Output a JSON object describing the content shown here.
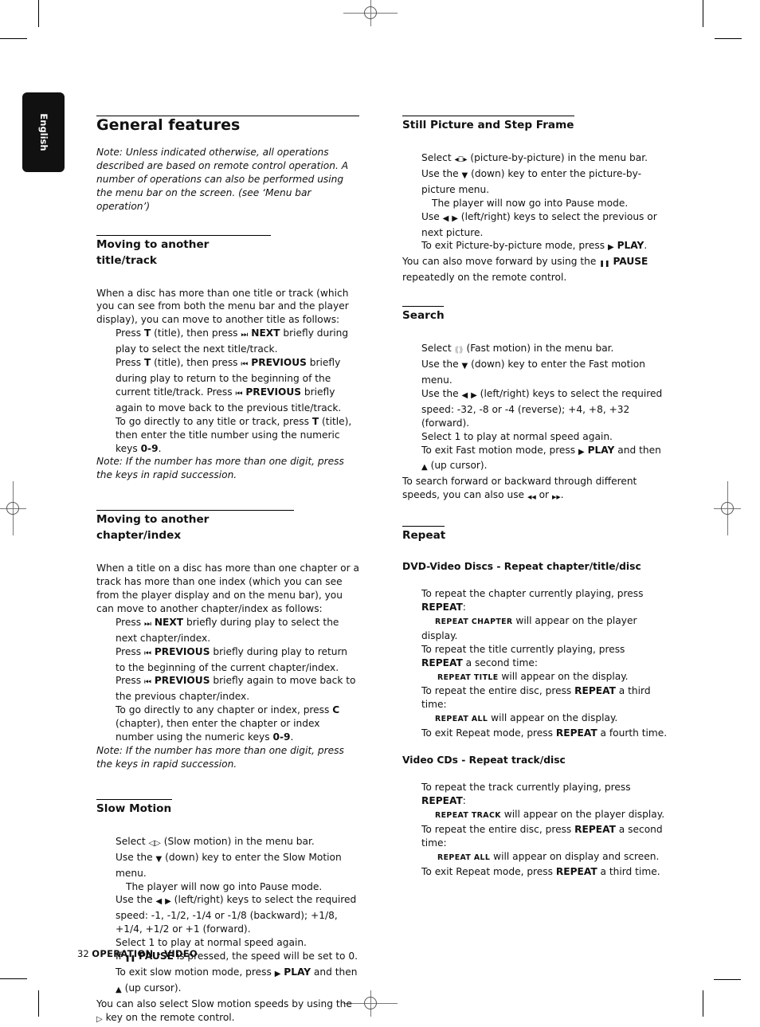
{
  "language_tab": "English",
  "page_title": "General features",
  "intro_note": "Note: Unless indicated otherwise, all operations described are based on remote control operation. A number of operations can also be performed using the menu bar on the screen. (see ‘Menu bar operation’)",
  "sections": {
    "title_track": {
      "heading": "Moving to another title/track",
      "intro": "When a disc has more than one title or track (which you can see from both the menu bar and the player display), you can move to another title as follows:",
      "step1": {
        "a": "Press ",
        "key": "T",
        "b": " (title), then press ",
        "btn": "NEXT",
        "c": " briefly during play to select the next title/track."
      },
      "step2": {
        "a": "Press ",
        "key": "T",
        "b": " (title), then press ",
        "btn": "PREVIOUS",
        "c": " briefly during play to return to the beginning of the current title/track. Press ",
        "btn2": "PREVIOUS",
        "d": " briefly again to move back to the previous title/track."
      },
      "step3": {
        "a": "To go directly to any title or track, press ",
        "key": "T",
        "b": " (title), then enter the title number using the numeric keys ",
        "keys": "0-9",
        "c": "."
      },
      "note": "Note: If the number has more than one digit, press the keys in rapid succession."
    },
    "chapter_index": {
      "heading": "Moving to another chapter/index",
      "intro": "When a title on a disc has more than one chapter or a track has more than one index (which you can see from the player display and on the menu bar), you can move to another chapter/index as follows:",
      "step1": {
        "a": "Press ",
        "btn": "NEXT",
        "b": " briefly during play to select the next chapter/index."
      },
      "step2": {
        "a": "Press ",
        "btn": "PREVIOUS",
        "b": " briefly during play to return to the beginning of the current chapter/index."
      },
      "step3": {
        "a": "Press ",
        "btn": "PREVIOUS",
        "b": " briefly again to move back to the previous chapter/index."
      },
      "step4": {
        "a": "To go directly to any chapter or index, press ",
        "key": "C",
        "b": " (chapter), then enter the chapter or index number using the numeric keys ",
        "keys": "0-9",
        "c": "."
      },
      "note": "Note: If the number has more than one digit, press the keys in rapid succession."
    },
    "slow_motion": {
      "heading": "Slow Motion",
      "s1a": "Select ",
      "s1b": " (Slow motion) in the menu bar.",
      "s2a": "Use the ",
      "s2b": " (down) key to enter the Slow Motion menu.",
      "s3": "The player will now go into Pause mode.",
      "s4a": "Use the ",
      "s4b": " (left/right) keys to select the required speed: -1, -1/2, -1/4 or -1/8 (backward); +1/8, +1/4, +1/2 or +1 (forward).",
      "s5": "Select 1 to play at normal speed again.",
      "s6a": "If ",
      "s6btn": "PAUSE",
      "s6b": " is pressed, the speed will be set to 0.",
      "s7a": "To exit slow motion mode, press ",
      "s7btn": "PLAY",
      "s7b": " and then",
      "s8": " (up cursor).",
      "s9a": "You can also select Slow motion speeds by using the ",
      "s9b": " key on the remote control."
    },
    "still_picture": {
      "heading": "Still Picture and Step Frame",
      "s1a": "Select ",
      "s1b": " (picture-by-picture) in the menu bar.",
      "s2a": "Use the ",
      "s2b": " (down) key to enter the picture-by-picture menu.",
      "s3": "The player will now go into Pause mode.",
      "s4a": "Use ",
      "s4b": " (left/right) keys to select the previous or next picture.",
      "s5a": "To exit Picture-by-picture mode, press ",
      "s5btn": "PLAY",
      "s5b": ".",
      "s6a": "You can also move forward by using the ",
      "s6btn": "PAUSE",
      "s6b": " repeatedly on the remote control."
    },
    "search": {
      "heading": "Search",
      "s1a": "Select ",
      "s1b": " (Fast motion) in the menu bar.",
      "s2a": "Use the ",
      "s2b": " (down) key to enter the Fast motion menu.",
      "s3a": "Use the ",
      "s3b": " (left/right) keys to select the required speed: -32, -8 or -4 (reverse); +4, +8, +32 (forward).",
      "s4": "Select 1 to play at normal speed again.",
      "s5a": "To exit Fast motion mode, press ",
      "s5btn": "PLAY",
      "s5b": " and then",
      "s6": " (up cursor).",
      "s7a": "To search forward or backward through different speeds, you can also use ",
      "s7b": " or ",
      "s7c": "."
    },
    "repeat": {
      "heading": "Repeat",
      "dvd_heading": "DVD-Video Discs - Repeat chapter/title/disc",
      "dvd": {
        "s1a": "To repeat the chapter currently playing, press ",
        "s1btn": "REPEAT",
        "s1b": ":",
        "s2sc": "REPEAT CHAPTER",
        "s2b": " will appear on the player display.",
        "s3a": "To repeat the title currently playing, press ",
        "s3btn": "REPEAT",
        "s3b": " a second time:",
        "s4sc": "REPEAT TITLE",
        "s4b": " will appear on the display.",
        "s5a": "To repeat the entire disc, press ",
        "s5btn": "REPEAT",
        "s5b": " a third time:",
        "s6sc": "REPEAT ALL",
        "s6b": " will appear on the display.",
        "s7a": "To exit Repeat mode, press ",
        "s7btn": "REPEAT",
        "s7b": " a fourth time."
      },
      "vcd_heading": "Video CDs - Repeat track/disc",
      "vcd": {
        "s1a": "To repeat the track currently playing, press ",
        "s1btn": "REPEAT",
        "s1b": ":",
        "s2sc": "REPEAT TRACK",
        "s2b": " will appear on the player display.",
        "s3a": "To repeat the entire disc, press ",
        "s3btn": "REPEAT",
        "s3b": " a second time:",
        "s4sc": "REPEAT ALL",
        "s4b": " will appear on display and screen.",
        "s5a": "To exit Repeat mode, press ",
        "s5btn": "REPEAT",
        "s5b": " a third time."
      }
    }
  },
  "footer": {
    "page_number": "32",
    "section": "OPERATION - VIDEO"
  },
  "icons": {
    "next": "⏭",
    "previous": "⏮",
    "down": "▼",
    "up": "▲",
    "left": "◀",
    "right": "▶",
    "play": "▶",
    "pause": "❚❚",
    "rewind": "◀◀",
    "forward": "▶▶"
  }
}
